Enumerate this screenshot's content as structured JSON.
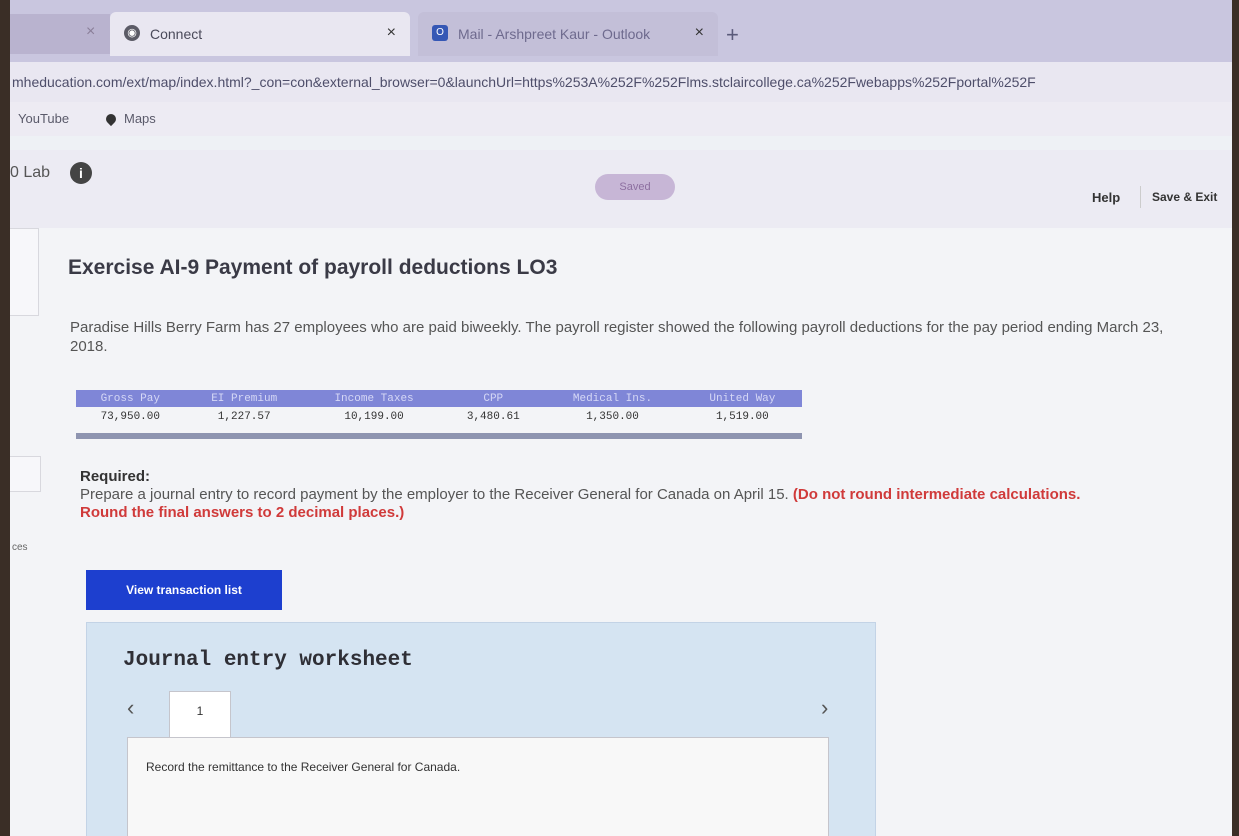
{
  "browser": {
    "tabs": [
      {
        "title": "Connect",
        "active": true
      },
      {
        "title": "Mail - Arshpreet Kaur - Outlook",
        "active": false
      }
    ],
    "url": "mheducation.com/ext/map/index.html?_con=con&external_browser=0&launchUrl=https%253A%252F%252Flms.stclaircollege.ca%252Fwebapps%252Fportal%252F",
    "bookmarks": [
      "YouTube",
      "Maps"
    ]
  },
  "header": {
    "lab_title": "0 Lab",
    "saved": "Saved",
    "help": "Help",
    "save_exit": "Save & Exit"
  },
  "sidebar": {
    "label": "ces"
  },
  "exercise": {
    "title": "Exercise AI-9 Payment of payroll deductions LO3",
    "problem": "Paradise Hills Berry Farm has 27 employees who are paid biweekly. The payroll register showed the following payroll deductions for the pay period ending March 23, 2018.",
    "table": {
      "headers": [
        "Gross Pay",
        "EI Premium",
        "Income Taxes",
        "CPP",
        "Medical Ins.",
        "United Way"
      ],
      "row": [
        "73,950.00",
        "1,227.57",
        "10,199.00",
        "3,480.61",
        "1,350.00",
        "1,519.00"
      ]
    },
    "required_label": "Required:",
    "instruction_main": "Prepare a journal entry to record payment by the employer to the Receiver General for Canada on April 15.",
    "instruction_note": "(Do not round intermediate calculations. Round the final answers to 2 decimal places.)"
  },
  "buttons": {
    "view_transactions": "View transaction list"
  },
  "worksheet": {
    "title": "Journal entry worksheet",
    "step": "1",
    "description": "Record the remittance to the Receiver General for Canada."
  }
}
